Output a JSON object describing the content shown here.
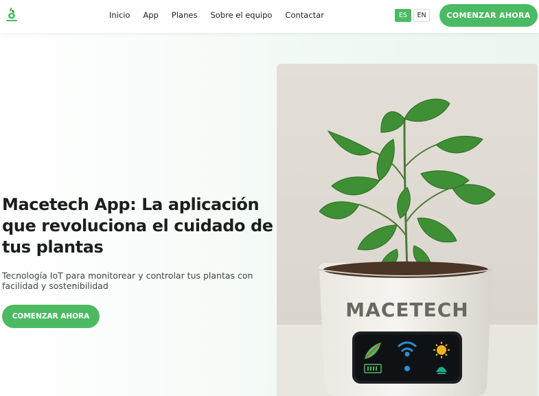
{
  "header": {
    "nav": [
      "Inicio",
      "App",
      "Planes",
      "Sobre el equipo",
      "Contactar"
    ],
    "lang": [
      "ES",
      "EN"
    ],
    "active_lang": "ES",
    "cta": "COMENZAR AHORA"
  },
  "hero": {
    "title": "Macetech App: La aplicación que revoluciona el cuidado de tus plantas",
    "subtitle": "Tecnología IoT para monitorear y controlar tus plantas con facilidad y sostenibilidad",
    "cta": "COMENZAR AHORA",
    "pot_brand": "MACETECH"
  },
  "colors": {
    "accent": "#4cba63",
    "pot": "#f1efea",
    "leaf": "#3f8f35"
  },
  "icons": [
    "logo-icon",
    "leaf-icon",
    "wifi-icon",
    "sun-icon",
    "battery-icon",
    "dot-icon",
    "gauge-icon"
  ]
}
